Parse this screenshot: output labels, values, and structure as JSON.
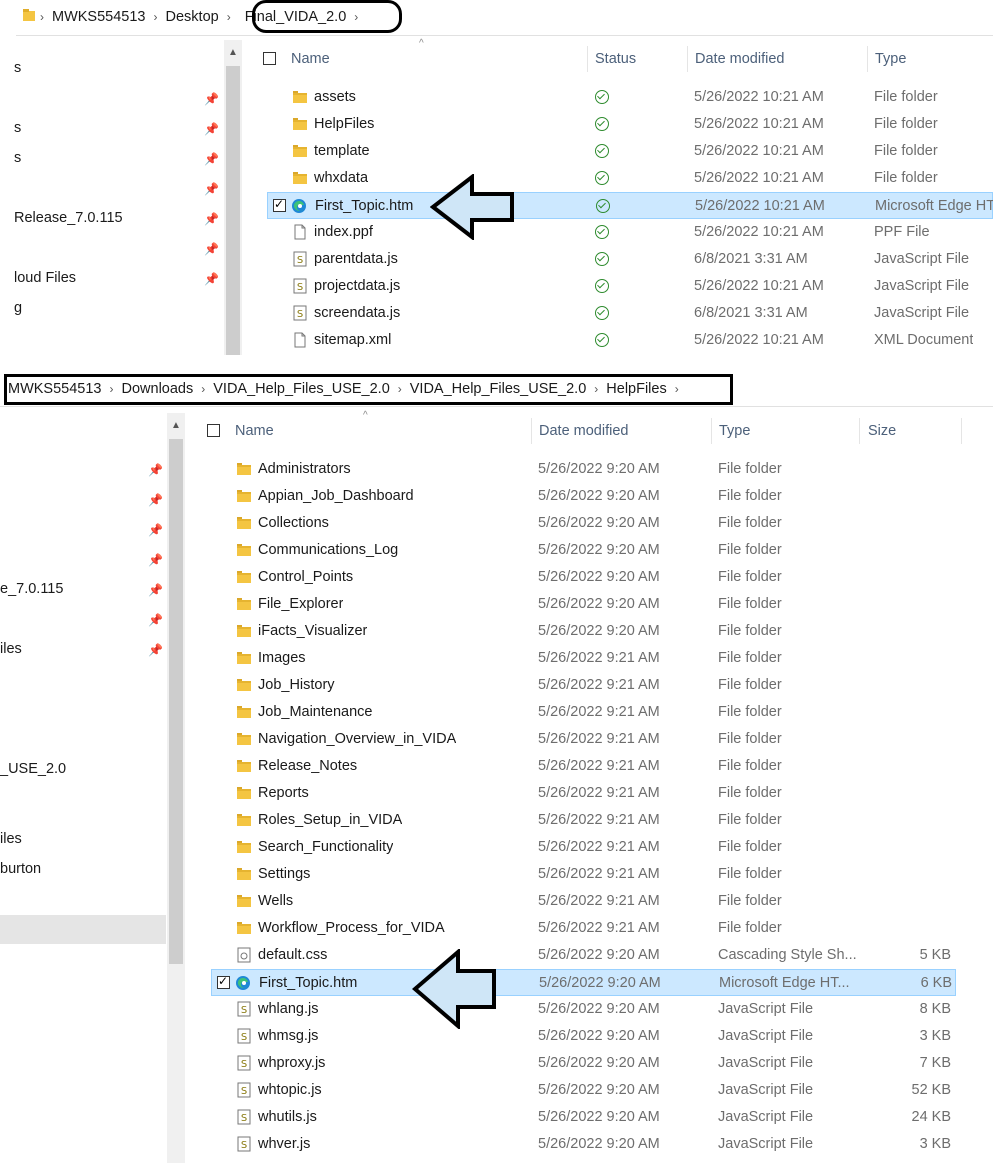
{
  "top": {
    "breadcrumb": [
      "MWKS554513",
      "Desktop",
      "Final_VIDA_2.0"
    ],
    "nav_items": [
      "s",
      "s",
      "s",
      "Release_7.0.115",
      "loud Files",
      "g"
    ],
    "columns": {
      "name": "Name",
      "status": "Status",
      "date": "Date modified",
      "type": "Type"
    },
    "files": [
      {
        "name": "assets",
        "icon": "folder-icon",
        "date": "5/26/2022 10:21 AM",
        "type": "File folder"
      },
      {
        "name": "HelpFiles",
        "icon": "folder-icon",
        "date": "5/26/2022 10:21 AM",
        "type": "File folder"
      },
      {
        "name": "template",
        "icon": "folder-icon",
        "date": "5/26/2022 10:21 AM",
        "type": "File folder"
      },
      {
        "name": "whxdata",
        "icon": "folder-icon",
        "date": "5/26/2022 10:21 AM",
        "type": "File folder"
      },
      {
        "name": "First_Topic.htm",
        "icon": "edge-icon",
        "date": "5/26/2022 10:21 AM",
        "type": "Microsoft Edge HT",
        "selected": true
      },
      {
        "name": "index.ppf",
        "icon": "file-icon",
        "date": "5/26/2022 10:21 AM",
        "type": "PPF File"
      },
      {
        "name": "parentdata.js",
        "icon": "js-file-icon",
        "date": "6/8/2021 3:31 AM",
        "type": "JavaScript File"
      },
      {
        "name": "projectdata.js",
        "icon": "js-file-icon",
        "date": "5/26/2022 10:21 AM",
        "type": "JavaScript File"
      },
      {
        "name": "screendata.js",
        "icon": "js-file-icon",
        "date": "6/8/2021 3:31 AM",
        "type": "JavaScript File"
      },
      {
        "name": "sitemap.xml",
        "icon": "file-icon",
        "date": "5/26/2022 10:21 AM",
        "type": "XML Document"
      }
    ]
  },
  "bottom": {
    "breadcrumb": [
      "MWKS554513",
      "Downloads",
      "VIDA_Help_Files_USE_2.0",
      "VIDA_Help_Files_USE_2.0",
      "HelpFiles"
    ],
    "nav_items": [
      "e_7.0.115",
      "iles",
      "_USE_2.0",
      "iles",
      "burton"
    ],
    "columns": {
      "name": "Name",
      "date": "Date modified",
      "type": "Type",
      "size": "Size"
    },
    "files": [
      {
        "name": "Administrators",
        "icon": "folder-icon",
        "date": "5/26/2022 9:20 AM",
        "type": "File folder",
        "size": ""
      },
      {
        "name": "Appian_Job_Dashboard",
        "icon": "folder-icon",
        "date": "5/26/2022 9:20 AM",
        "type": "File folder",
        "size": ""
      },
      {
        "name": "Collections",
        "icon": "folder-icon",
        "date": "5/26/2022 9:20 AM",
        "type": "File folder",
        "size": ""
      },
      {
        "name": "Communications_Log",
        "icon": "folder-icon",
        "date": "5/26/2022 9:20 AM",
        "type": "File folder",
        "size": ""
      },
      {
        "name": "Control_Points",
        "icon": "folder-icon",
        "date": "5/26/2022 9:20 AM",
        "type": "File folder",
        "size": ""
      },
      {
        "name": "File_Explorer",
        "icon": "folder-icon",
        "date": "5/26/2022 9:20 AM",
        "type": "File folder",
        "size": ""
      },
      {
        "name": "iFacts_Visualizer",
        "icon": "folder-icon",
        "date": "5/26/2022 9:20 AM",
        "type": "File folder",
        "size": ""
      },
      {
        "name": "Images",
        "icon": "folder-icon",
        "date": "5/26/2022 9:21 AM",
        "type": "File folder",
        "size": ""
      },
      {
        "name": "Job_History",
        "icon": "folder-icon",
        "date": "5/26/2022 9:21 AM",
        "type": "File folder",
        "size": ""
      },
      {
        "name": "Job_Maintenance",
        "icon": "folder-icon",
        "date": "5/26/2022 9:21 AM",
        "type": "File folder",
        "size": ""
      },
      {
        "name": "Navigation_Overview_in_VIDA",
        "icon": "folder-icon",
        "date": "5/26/2022 9:21 AM",
        "type": "File folder",
        "size": ""
      },
      {
        "name": "Release_Notes",
        "icon": "folder-icon",
        "date": "5/26/2022 9:21 AM",
        "type": "File folder",
        "size": ""
      },
      {
        "name": "Reports",
        "icon": "folder-icon",
        "date": "5/26/2022 9:21 AM",
        "type": "File folder",
        "size": ""
      },
      {
        "name": "Roles_Setup_in_VIDA",
        "icon": "folder-icon",
        "date": "5/26/2022 9:21 AM",
        "type": "File folder",
        "size": ""
      },
      {
        "name": "Search_Functionality",
        "icon": "folder-icon",
        "date": "5/26/2022 9:21 AM",
        "type": "File folder",
        "size": ""
      },
      {
        "name": "Settings",
        "icon": "folder-icon",
        "date": "5/26/2022 9:21 AM",
        "type": "File folder",
        "size": ""
      },
      {
        "name": "Wells",
        "icon": "folder-icon",
        "date": "5/26/2022 9:21 AM",
        "type": "File folder",
        "size": ""
      },
      {
        "name": "Workflow_Process_for_VIDA",
        "icon": "folder-icon",
        "date": "5/26/2022 9:21 AM",
        "type": "File folder",
        "size": ""
      },
      {
        "name": "default.css",
        "icon": "css-file-icon",
        "date": "5/26/2022 9:20 AM",
        "type": "Cascading Style Sh...",
        "size": "5 KB"
      },
      {
        "name": "First_Topic.htm",
        "icon": "edge-icon",
        "date": "5/26/2022 9:20 AM",
        "type": "Microsoft Edge HT...",
        "size": "6 KB",
        "selected": true
      },
      {
        "name": "whlang.js",
        "icon": "js-file-icon",
        "date": "5/26/2022 9:20 AM",
        "type": "JavaScript File",
        "size": "8 KB"
      },
      {
        "name": "whmsg.js",
        "icon": "js-file-icon",
        "date": "5/26/2022 9:20 AM",
        "type": "JavaScript File",
        "size": "3 KB"
      },
      {
        "name": "whproxy.js",
        "icon": "js-file-icon",
        "date": "5/26/2022 9:20 AM",
        "type": "JavaScript File",
        "size": "7 KB"
      },
      {
        "name": "whtopic.js",
        "icon": "js-file-icon",
        "date": "5/26/2022 9:20 AM",
        "type": "JavaScript File",
        "size": "52 KB"
      },
      {
        "name": "whutils.js",
        "icon": "js-file-icon",
        "date": "5/26/2022 9:20 AM",
        "type": "JavaScript File",
        "size": "24 KB"
      },
      {
        "name": "whver.js",
        "icon": "js-file-icon",
        "date": "5/26/2022 9:20 AM",
        "type": "JavaScript File",
        "size": "3 KB"
      }
    ]
  },
  "colors": {
    "selection": "#cce8ff",
    "folder": "#f4c542",
    "status_ok": "#2e8b2e",
    "arrow_fill": "#cfe6f7"
  }
}
